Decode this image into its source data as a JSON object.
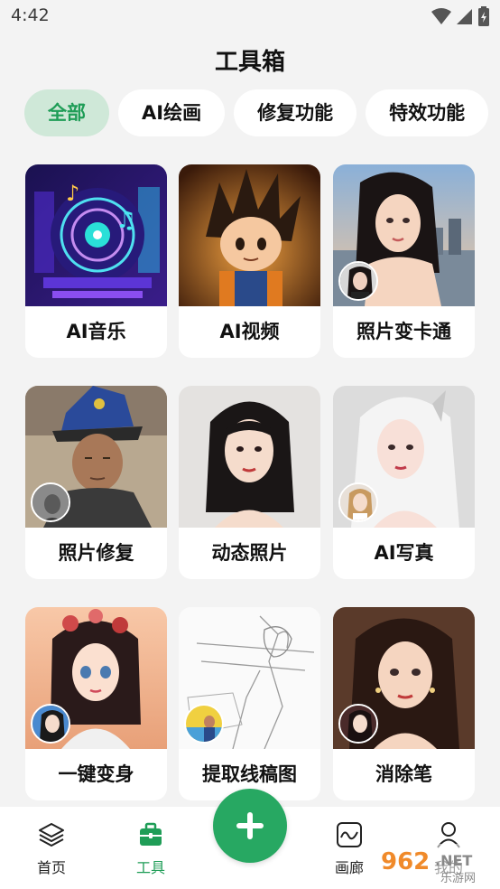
{
  "status": {
    "time": "4:42"
  },
  "page": {
    "title": "工具箱"
  },
  "tabs": [
    {
      "label": "全部",
      "active": true
    },
    {
      "label": "AI绘画",
      "active": false
    },
    {
      "label": "修复功能",
      "active": false
    },
    {
      "label": "特效功能",
      "active": false
    }
  ],
  "tools": [
    {
      "label": "AI音乐",
      "image": "music-turntable"
    },
    {
      "label": "AI视频",
      "image": "anime-character"
    },
    {
      "label": "照片变卡通",
      "image": "cartoon-woman-city"
    },
    {
      "label": "照片修复",
      "image": "elderly-woman-photo"
    },
    {
      "label": "动态照片",
      "image": "woman-portrait"
    },
    {
      "label": "AI写真",
      "image": "white-hair-woman"
    },
    {
      "label": "一键变身",
      "image": "anime-girl-flowers"
    },
    {
      "label": "提取线稿图",
      "image": "line-sketch"
    },
    {
      "label": "消除笔",
      "image": "woman-portrait-earrings"
    }
  ],
  "nav": {
    "home": "首页",
    "tools": "工具",
    "gallery": "画廊",
    "profile": "我的"
  },
  "watermark": {
    "number": "962",
    "suffix": ".NET",
    "sub": "乐游网"
  },
  "colors": {
    "accent": "#27a862",
    "active_tab_bg": "#cfe8d8",
    "background": "#f3f3f3"
  }
}
